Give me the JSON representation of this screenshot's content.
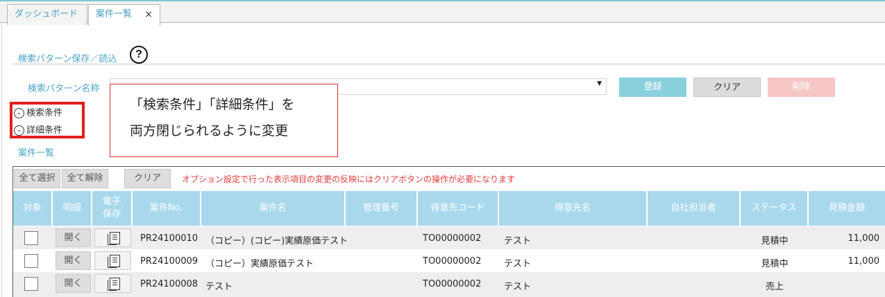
{
  "tabs": [
    {
      "label": "ダッシュボード"
    },
    {
      "label": "案件一覧",
      "close": "×"
    }
  ],
  "search_pattern": {
    "section_title": "検索パターン保存／読込",
    "help": "?",
    "name_label": "検索パターン名称",
    "select_value": "",
    "register_label": "登録",
    "clear_label": "クリア",
    "delete_label": "削除"
  },
  "toggles": {
    "search_conditions": "検索条件",
    "detail_conditions": "詳細条件"
  },
  "callout": {
    "line1": "「検索条件」「詳細条件」を",
    "line2": "両方閉じられるように変更"
  },
  "list": {
    "title": "案件一覧",
    "select_all": "全て選択",
    "deselect_all": "全て解除",
    "clear": "クリア",
    "notice": "オプション設定で行った表示項目の変更の反映にはクリアボタンの操作が必要になります"
  },
  "table": {
    "headers": {
      "target": "対象",
      "detail": "明細",
      "esave_1": "電子",
      "esave_2": "保存",
      "case_no": "案件No.",
      "case_name": "案件名",
      "mgmt_no": "管理番号",
      "client_code": "得意先コード",
      "client_name": "得意先名",
      "staff": "自社担当者",
      "status": "ステータス",
      "estimate": "見積金額"
    },
    "open_label": "開く",
    "rows": [
      {
        "case_no": "PR24100010",
        "case_name": "（コピー）(コピー)実績原価テスト",
        "mgmt_no": "",
        "client_code": "TO00000002",
        "client_name": "テスト",
        "staff": "",
        "status": "見積中",
        "estimate": "11,000"
      },
      {
        "case_no": "PR24100009",
        "case_name": "（コピー）実績原価テスト",
        "mgmt_no": "",
        "client_code": "TO00000002",
        "client_name": "テスト",
        "staff": "",
        "status": "見積中",
        "estimate": "11,000"
      },
      {
        "case_no": "PR24100008",
        "case_name": "テスト",
        "mgmt_no": "",
        "client_code": "TO00000002",
        "client_name": "テスト",
        "staff": "",
        "status": "売上",
        "estimate": ""
      }
    ]
  },
  "colors": {
    "accent": "#4aa3c6",
    "header_bg": "#a9d8ec",
    "register_bg": "#8ad0dc",
    "delete_bg": "#f6c6c6",
    "notice": "#e23a3a",
    "highlight": "#e41d1d"
  }
}
